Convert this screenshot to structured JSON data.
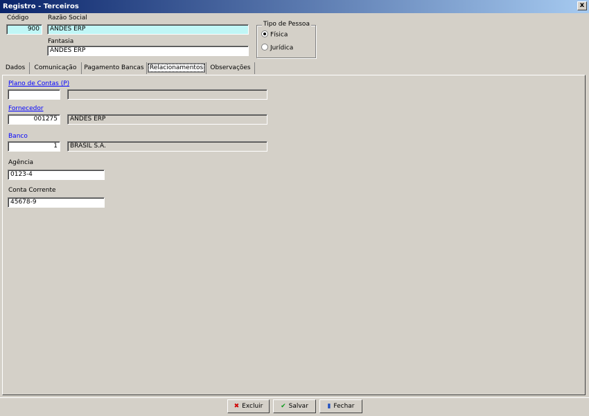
{
  "window": {
    "title": "Registro - Terceiros",
    "close_label": "x"
  },
  "header": {
    "codigo_label": "Código",
    "codigo_value": "900",
    "razao_label": "Razão Social",
    "razao_value": "ANDES ERP",
    "fantasia_label": "Fantasia",
    "fantasia_value": "ANDES ERP"
  },
  "tipo_pessoa": {
    "title": "Tipo de Pessoa",
    "options": [
      "Física",
      "Jurídica"
    ],
    "selected": "Física"
  },
  "tabs": [
    "Dados",
    "Comunicação",
    "Pagamento Bancas",
    "Relacionamentos",
    "Observações"
  ],
  "active_tab": "Relacionamentos",
  "relacionamentos": {
    "plano_label": "Plano de Contas (P)",
    "plano_code": "",
    "plano_desc": "",
    "fornecedor_label": "Fornecedor",
    "fornecedor_code": "001275",
    "fornecedor_desc": "ANDES ERP",
    "banco_label": "Banco",
    "banco_code": "1",
    "banco_desc": "BRASIL S.A.",
    "agencia_label": "Agência",
    "agencia_value": "0123-4",
    "conta_label": "Conta Corrente",
    "conta_value": "45678-9"
  },
  "buttons": {
    "excluir": "Excluir",
    "salvar": "Salvar",
    "fechar": "Fechar"
  },
  "colors": {
    "title_start": "#0a246a",
    "title_end": "#a6caf0",
    "highlight_field": "#c0f6f6",
    "link": "#0000ff"
  }
}
